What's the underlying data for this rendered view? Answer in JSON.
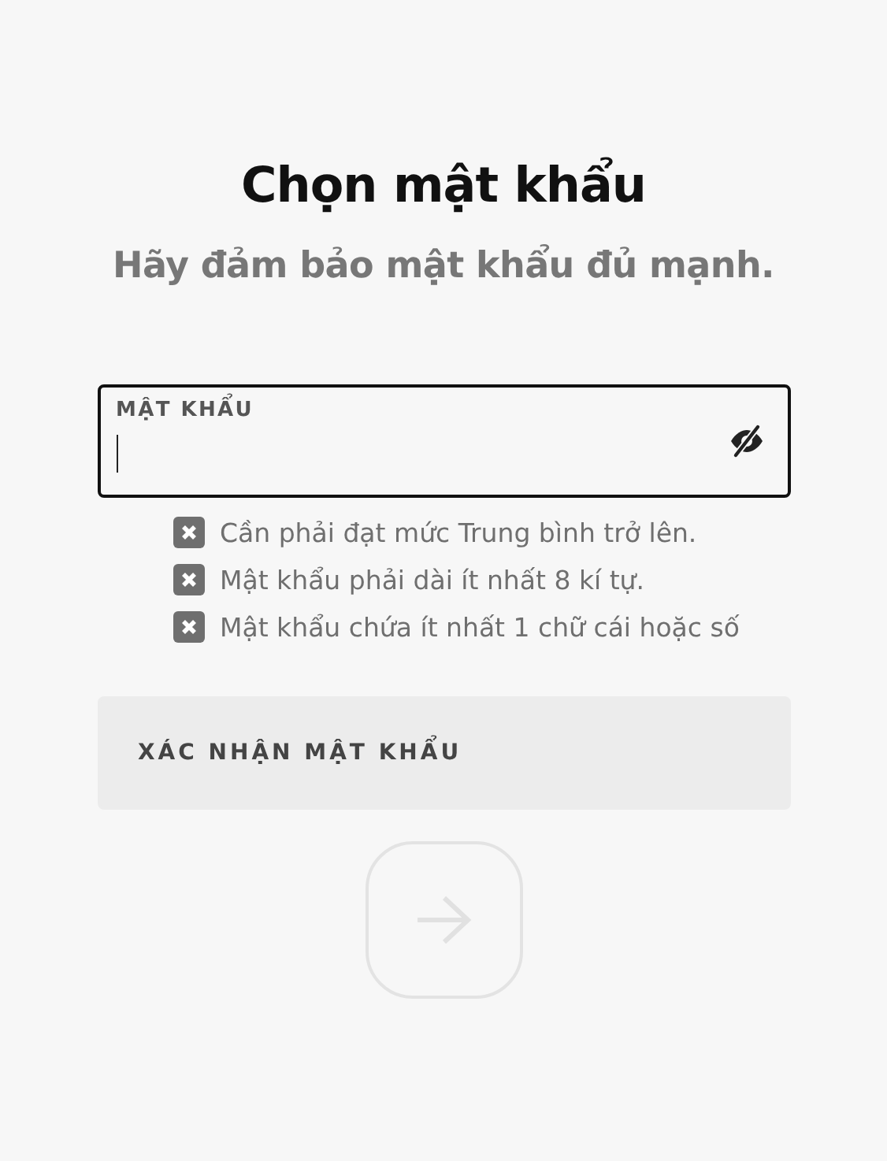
{
  "title": "Chọn mật khẩu",
  "subtitle": "Hãy đảm bảo mật khẩu đủ mạnh.",
  "password_field": {
    "label": "MẬT KHẨU",
    "focused": true,
    "masked": true
  },
  "requirements": [
    {
      "text": "Cần phải đạt mức Trung bình trở lên.",
      "met": false
    },
    {
      "text": "Mật khẩu phải dài ít nhất 8 kí tự.",
      "met": false
    },
    {
      "text": "Mật khẩu chứa ít nhất 1 chữ cái hoặc số",
      "met": false
    }
  ],
  "confirm_field": {
    "label": "XÁC NHẬN MẬT KHẨU",
    "focused": false
  },
  "next_button": {
    "disabled": true
  }
}
